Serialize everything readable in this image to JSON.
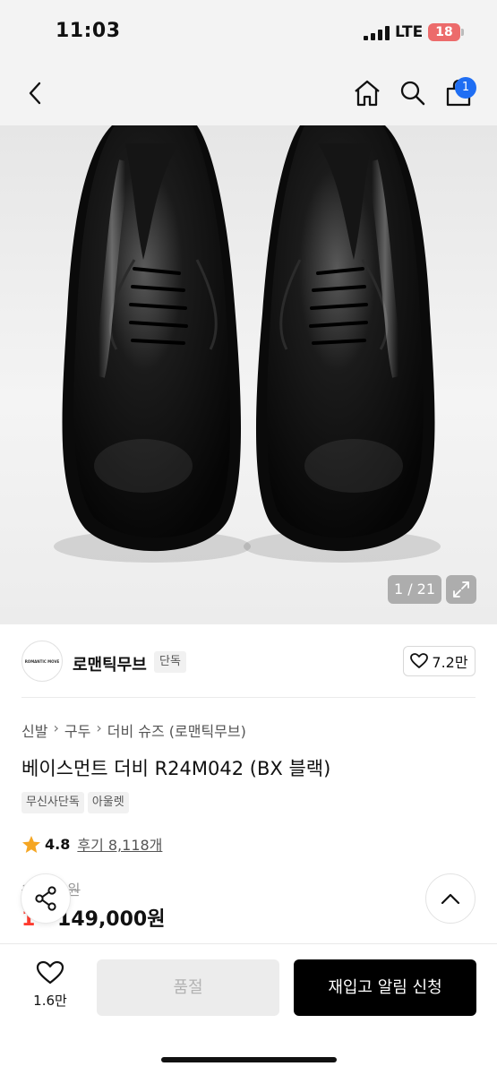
{
  "status_bar": {
    "time": "11:03",
    "network": "LTE",
    "battery": "18"
  },
  "nav": {
    "cart_count": "1",
    "icons": [
      "back-arrow-icon",
      "home-icon",
      "search-icon",
      "cart-icon"
    ]
  },
  "gallery": {
    "counter": "1 / 21",
    "image": "black patent leather derby shoes pair"
  },
  "brand": {
    "name": "로맨틱무브",
    "tag": "단독",
    "likes": "7.2만",
    "logo_text": "ROMANTIC MOVE"
  },
  "breadcrumb": [
    "신발",
    "구두",
    "더비 슈즈 (로맨틱무브)"
  ],
  "product": {
    "title": "베이스먼트 더비 R24M042 (BX 블랙)",
    "tags": [
      "무신사단독",
      "아울렛"
    ],
    "rating": "4.8",
    "reviews": "후기 8,118개",
    "original_price": "1··,·00원",
    "discount": "1··",
    "price": "149,000원"
  },
  "bottom_bar": {
    "wish_count": "1.6만",
    "soldout_label": "품절",
    "restock_label": "재입고 알림 신청"
  },
  "colors": {
    "accent_blue": "#1f6ef3",
    "discount_red": "#ff3b2f",
    "star": "#f5a623"
  }
}
